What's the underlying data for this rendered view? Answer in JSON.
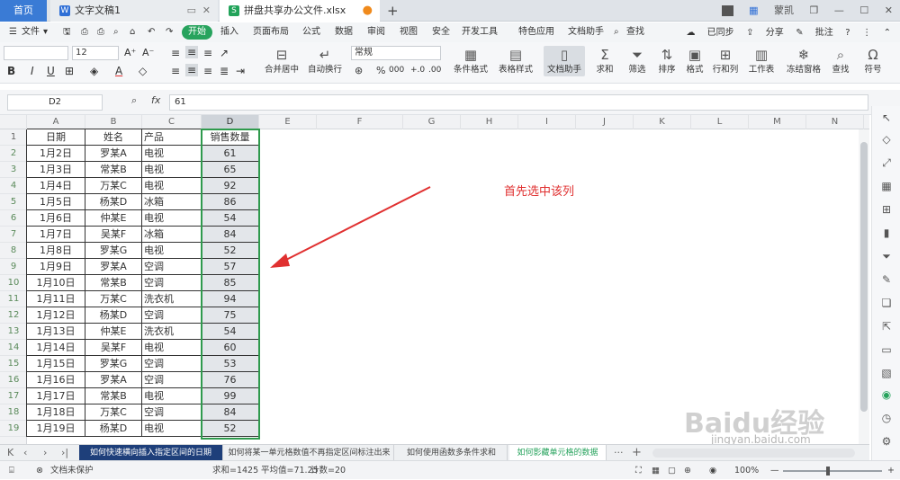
{
  "titlebar": {
    "tabs": [
      {
        "label": "首页"
      },
      {
        "label": "文字文稿1",
        "icon": "W"
      },
      {
        "label": "拼盘共享办公文件.xlsx",
        "icon": "S"
      }
    ],
    "window_count": "2",
    "user": "蒙凯"
  },
  "menubar": {
    "file": "文件",
    "start": "开始",
    "items": [
      "插入",
      "页面布局",
      "公式",
      "数据",
      "审阅",
      "视图",
      "安全",
      "开发工具",
      "特色应用",
      "文档助手"
    ],
    "search": "查找",
    "sync": "已同步",
    "share": "分享",
    "comment": "批注",
    "help": "?"
  },
  "ribbon": {
    "font_name": "",
    "font_size": "12",
    "number_format": "常规",
    "merge": "合并居中",
    "wrap": "自动换行",
    "cond_format": "条件格式",
    "table_style": "表格样式",
    "doc_helper": "文档助手",
    "sum": "求和",
    "filter": "筛选",
    "sort": "排序",
    "format": "格式",
    "rowcol": "行和列",
    "sheet": "工作表",
    "freeze": "冻结窗格",
    "find": "查找",
    "symbol": "符号",
    "percent": "%",
    "thousands": "000"
  },
  "formula_bar": {
    "cell_ref": "D2",
    "fx": "fx",
    "value": "61"
  },
  "columns": [
    "A",
    "B",
    "C",
    "D",
    "E",
    "F",
    "G",
    "H",
    "I",
    "J",
    "K",
    "L",
    "M",
    "N"
  ],
  "table": {
    "headers": [
      "日期",
      "姓名",
      "产品",
      "销售数量"
    ],
    "rows": [
      [
        "1月2日",
        "罗某A",
        "电视",
        "61"
      ],
      [
        "1月3日",
        "常某B",
        "电视",
        "65"
      ],
      [
        "1月4日",
        "万某C",
        "电视",
        "92"
      ],
      [
        "1月5日",
        "杨某D",
        "冰箱",
        "86"
      ],
      [
        "1月6日",
        "仲某E",
        "电视",
        "54"
      ],
      [
        "1月7日",
        "吴某F",
        "冰箱",
        "84"
      ],
      [
        "1月8日",
        "罗某G",
        "电视",
        "52"
      ],
      [
        "1月9日",
        "罗某A",
        "空调",
        "57"
      ],
      [
        "1月10日",
        "常某B",
        "空调",
        "85"
      ],
      [
        "1月11日",
        "万某C",
        "洗衣机",
        "94"
      ],
      [
        "1月12日",
        "杨某D",
        "空调",
        "75"
      ],
      [
        "1月13日",
        "仲某E",
        "洗衣机",
        "54"
      ],
      [
        "1月14日",
        "吴某F",
        "电视",
        "60"
      ],
      [
        "1月15日",
        "罗某G",
        "空调",
        "53"
      ],
      [
        "1月16日",
        "罗某A",
        "空调",
        "76"
      ],
      [
        "1月17日",
        "常某B",
        "电视",
        "99"
      ],
      [
        "1月18日",
        "万某C",
        "空调",
        "84"
      ],
      [
        "1月19日",
        "杨某D",
        "电视",
        "52"
      ]
    ]
  },
  "annotation": "首先选中该列",
  "sheet_tabs": [
    "如何快速横向插入指定区间的日期",
    "如何将某一单元格数值不再指定区间标注出来",
    "如何使用函数多条件求和",
    "如何影藏单元格的数据"
  ],
  "status": {
    "protect": "文档未保护",
    "sum": "求和=1425",
    "avg": "平均值=71.25",
    "count": "计数=20",
    "zoom": "100%"
  },
  "watermark": {
    "text": "Baidu经验",
    "url": "jingyan.baidu.com"
  },
  "colors": {
    "accent": "#27a35d",
    "select_border": "#2f9a4d",
    "annotation": "#e03030",
    "home_tab": "#3a7bd5"
  }
}
